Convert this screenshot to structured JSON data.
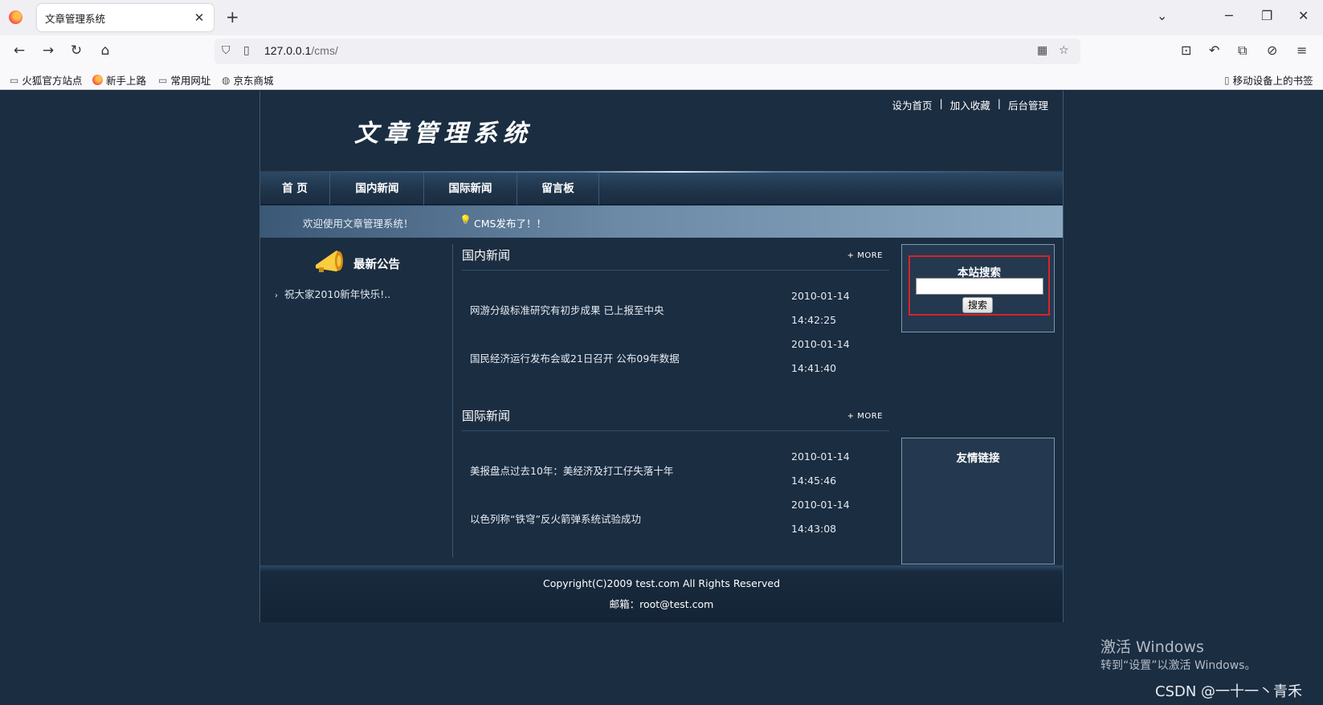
{
  "browser": {
    "tab_title": "文章管理系统",
    "tab_close": "✕",
    "new_tab": "+",
    "url_host": "127.0.0.1",
    "url_path": "/cms/",
    "bookmarks": [
      "火狐官方站点",
      "新手上路",
      "常用网址",
      "京东商城"
    ],
    "mobile_bookmarks": "移动设备上的书签"
  },
  "header": {
    "logo": "文章管理系统",
    "top_links": [
      "设为首页",
      "加入收藏",
      "后台管理"
    ],
    "separator": "|"
  },
  "menu": {
    "items": [
      "首 页",
      "国内新闻",
      "国际新闻",
      "留言板"
    ]
  },
  "ticker": {
    "welcome": "欢迎使用文章管理系统！",
    "news": "CMS发布了！！"
  },
  "notice": {
    "title": "最新公告",
    "items": [
      "祝大家2010新年快乐!.."
    ]
  },
  "domestic": {
    "title": "国内新闻",
    "more": "+ MORE",
    "rows": [
      {
        "title": "网游分级标准研究有初步成果 已上报至中央",
        "date": "2010-01-14",
        "time": "14:42:25"
      },
      {
        "title": "国民经济运行发布会或21日召开 公布09年数据",
        "date": "2010-01-14",
        "time": "14:41:40"
      }
    ]
  },
  "international": {
    "title": "国际新闻",
    "more": "+ MORE",
    "rows": [
      {
        "title": "美报盘点过去10年：美经济及打工仔失落十年",
        "date": "2010-01-14",
        "time": "14:45:46"
      },
      {
        "title": "以色列称“铁穹”反火箭弹系统试验成功",
        "date": "2010-01-14",
        "time": "14:43:08"
      }
    ]
  },
  "search": {
    "title": "本站搜索",
    "button": "搜索",
    "value": ""
  },
  "links": {
    "title": "友情链接"
  },
  "footer": {
    "copyright": "Copyright(C)2009 test.com All Rights Reserved",
    "email": "邮箱：root@test.com"
  },
  "overlay": {
    "activate_title": "激活 Windows",
    "activate_sub": "转到“设置”以激活 Windows。",
    "csdn": "CSDN @一十一丶青禾"
  },
  "colors": {
    "page_bg": "#1b2d41",
    "search_highlight": "#d9232a"
  }
}
